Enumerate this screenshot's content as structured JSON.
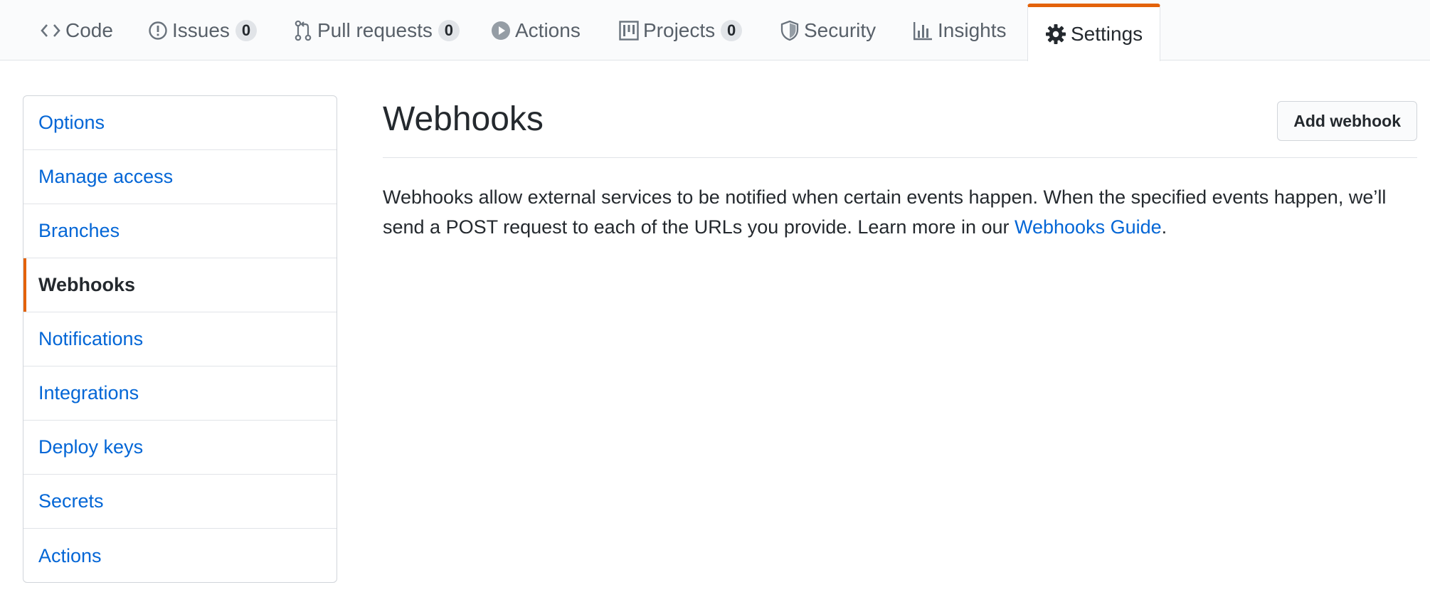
{
  "tabs": [
    {
      "label": "Code",
      "icon": "code-icon"
    },
    {
      "label": "Issues",
      "icon": "issue-icon",
      "count": "0"
    },
    {
      "label": "Pull requests",
      "icon": "pull-request-icon",
      "count": "0"
    },
    {
      "label": "Actions",
      "icon": "play-icon"
    },
    {
      "label": "Projects",
      "icon": "project-icon",
      "count": "0"
    },
    {
      "label": "Security",
      "icon": "shield-icon"
    },
    {
      "label": "Insights",
      "icon": "graph-icon"
    },
    {
      "label": "Settings",
      "icon": "gear-icon",
      "selected": true
    }
  ],
  "sidebar": {
    "items": [
      {
        "label": "Options"
      },
      {
        "label": "Manage access"
      },
      {
        "label": "Branches"
      },
      {
        "label": "Webhooks",
        "active": true
      },
      {
        "label": "Notifications"
      },
      {
        "label": "Integrations"
      },
      {
        "label": "Deploy keys"
      },
      {
        "label": "Secrets"
      },
      {
        "label": "Actions"
      }
    ]
  },
  "main": {
    "title": "Webhooks",
    "add_button": "Add webhook",
    "description": "Webhooks allow external services to be notified when certain events happen. When the specified events happen, we’ll send a POST request to each of the URLs you provide. Learn more in our ",
    "link_text": "Webhooks Guide",
    "description_end": "."
  },
  "colors": {
    "accent": "#e36209",
    "link": "#0366d6",
    "text": "#24292e",
    "muted": "#586069"
  }
}
